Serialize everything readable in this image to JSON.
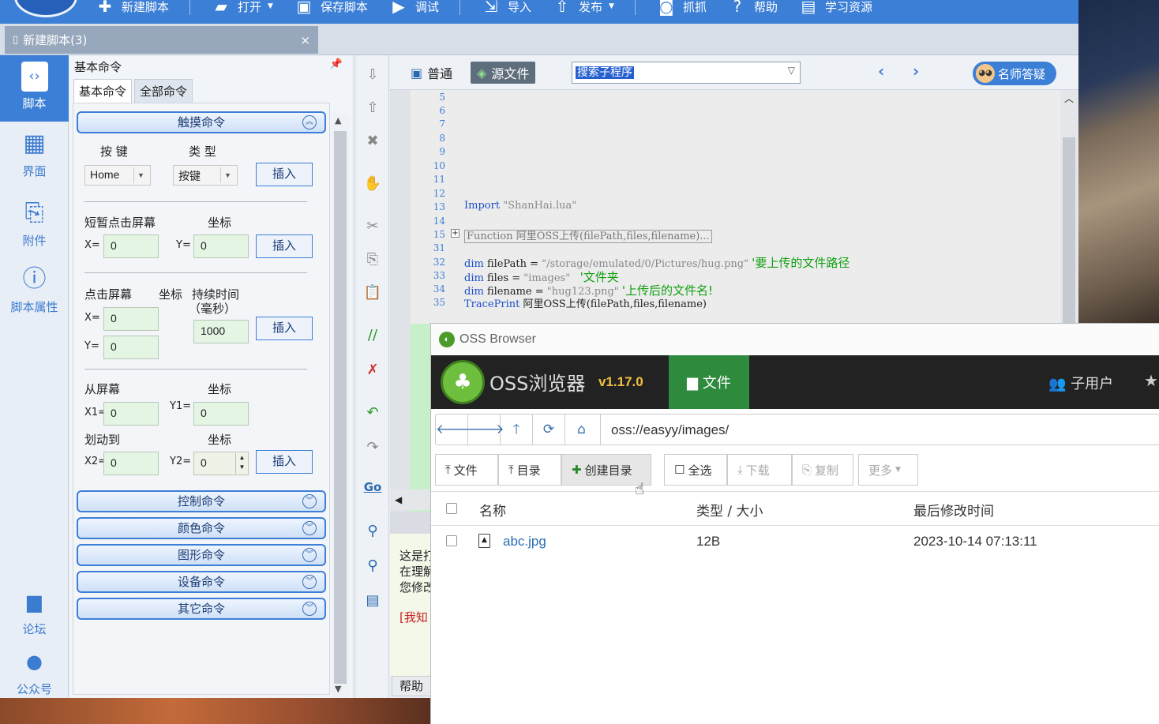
{
  "toolbar": {
    "items": [
      {
        "icon": "plus-icon",
        "label": "新建脚本"
      },
      {
        "icon": "folder-open-icon",
        "label": "打开"
      },
      {
        "icon": "save-icon",
        "label": "保存脚本"
      },
      {
        "icon": "play-icon",
        "label": "调试"
      },
      {
        "icon": "import-icon",
        "label": "导入"
      },
      {
        "icon": "publish-icon",
        "label": "发布"
      },
      {
        "icon": "camera-icon",
        "label": "抓抓"
      },
      {
        "icon": "help-icon",
        "label": "帮助"
      },
      {
        "icon": "book-icon",
        "label": "学习资源"
      }
    ]
  },
  "doc_tab": {
    "title": "新建脚本(3)",
    "close": "×"
  },
  "leftnav": {
    "script": "脚本",
    "ui": "界面",
    "attachment": "附件",
    "props": "脚本属性",
    "forum": "论坛",
    "wechat": "公众号"
  },
  "cmd_panel": {
    "title": "基本命令",
    "tabs": [
      "基本命令",
      "全部命令"
    ],
    "touch_group": "触摸命令",
    "key_label": "按 键",
    "type_label": "类 型",
    "key_value": "Home",
    "type_value": "按键",
    "insert": "插入",
    "tap_label": "短暂点击屏幕",
    "coord_label": "坐标",
    "x_eq": "X=",
    "y_eq": "Y=",
    "zero": "0",
    "press_label": "点击屏幕",
    "duration_label": "持续时间",
    "duration_unit": "（毫秒）",
    "duration_value": "1000",
    "from_label": "从屏幕",
    "to_label": "划动到",
    "x1_eq": "X1=",
    "y1_eq": "Y1=",
    "x2_eq": "X2=",
    "y2_eq": "Y2=",
    "groups": [
      "控制命令",
      "颜色命令",
      "图形命令",
      "设备命令",
      "其它命令"
    ]
  },
  "editor": {
    "normal": "普通",
    "source": "源文件",
    "search_value": "搜索子程序",
    "teacher": "名师答疑",
    "line_numbers": [
      "5",
      "6",
      "7",
      "8",
      "9",
      "10",
      "11",
      "12",
      "13",
      "14",
      "15",
      "31",
      "32",
      "33",
      "34",
      "35"
    ],
    "line13": {
      "kw": "Import",
      "str": "\"ShanHai.lua\""
    },
    "line15": "Function 阿里OSS上传(filePath,files,filename)...",
    "line32": {
      "kw": "dim",
      "code": " filePath = ",
      "str": "\"/storage/emulated/0/Pictures/hug.png\"",
      "cm": "'要上传的文件路径"
    },
    "line33": {
      "kw": "dim",
      "code": " files = ",
      "str": "\"images\"",
      "cm": "'文件夹"
    },
    "line34": {
      "kw": "dim",
      "code": " filename = ",
      "str": "\"hug123.png\"",
      "cm": "'上传后的文件名!"
    },
    "line35": {
      "kw": "TracePrint",
      "code": " 阿里OSS上传(filePath,files,filename)"
    },
    "info_lines": [
      "这是打",
      "在理解",
      "您修改"
    ],
    "info_red": "[我知",
    "help_tab": "帮助"
  },
  "oss": {
    "window_title": "OSS Browser",
    "brand": "OSS浏览器",
    "version": "v1.17.0",
    "files_tab": "文件",
    "subuser": "子用户",
    "address": "oss://easyy/images/",
    "actions": {
      "upload_file": "文件",
      "upload_dir": "目录",
      "create_dir": "创建目录",
      "select_all": "全选",
      "download": "下载",
      "copy": "复制",
      "more": "更多"
    },
    "columns": [
      "名称",
      "类型 / 大小",
      "最后修改时间"
    ],
    "rows": [
      {
        "name": "abc.jpg",
        "size": "12B",
        "modified": "2023-10-14 07:13:11"
      }
    ]
  }
}
